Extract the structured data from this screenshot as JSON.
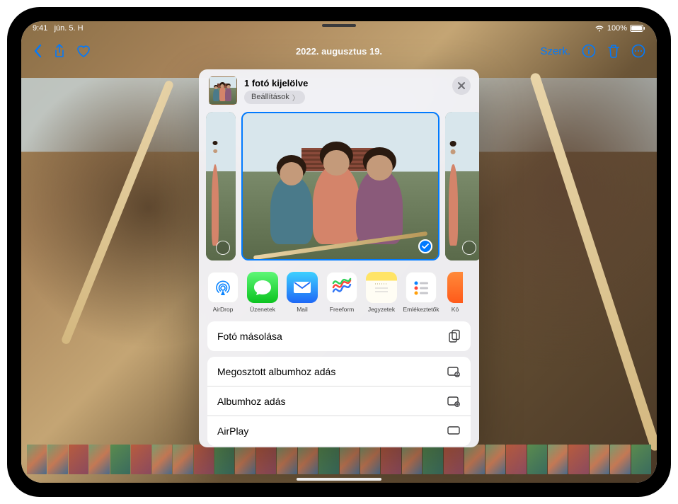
{
  "status": {
    "time": "9:41",
    "date": "jún. 5. H",
    "battery": "100%"
  },
  "nav": {
    "title": "2022. augusztus 19.",
    "edit": "Szerk."
  },
  "share": {
    "selected_title": "1 fotó kijelölve",
    "settings_label": "Beállítások",
    "apps": [
      {
        "id": "airdrop",
        "label": "AirDrop"
      },
      {
        "id": "messages",
        "label": "Üzenetek"
      },
      {
        "id": "mail",
        "label": "Mail"
      },
      {
        "id": "freeform",
        "label": "Freeform"
      },
      {
        "id": "notes",
        "label": "Jegyzetek"
      },
      {
        "id": "reminders",
        "label": "Emlékeztetők"
      },
      {
        "id": "more",
        "label": "Kö"
      }
    ],
    "actions1": [
      {
        "id": "copy",
        "label": "Fotó másolása",
        "icon": "copy"
      }
    ],
    "actions2": [
      {
        "id": "shared-album",
        "label": "Megosztott albumhoz adás",
        "icon": "shared-album"
      },
      {
        "id": "album",
        "label": "Albumhoz adás",
        "icon": "album"
      },
      {
        "id": "airplay",
        "label": "AirPlay",
        "icon": "airplay"
      }
    ]
  }
}
